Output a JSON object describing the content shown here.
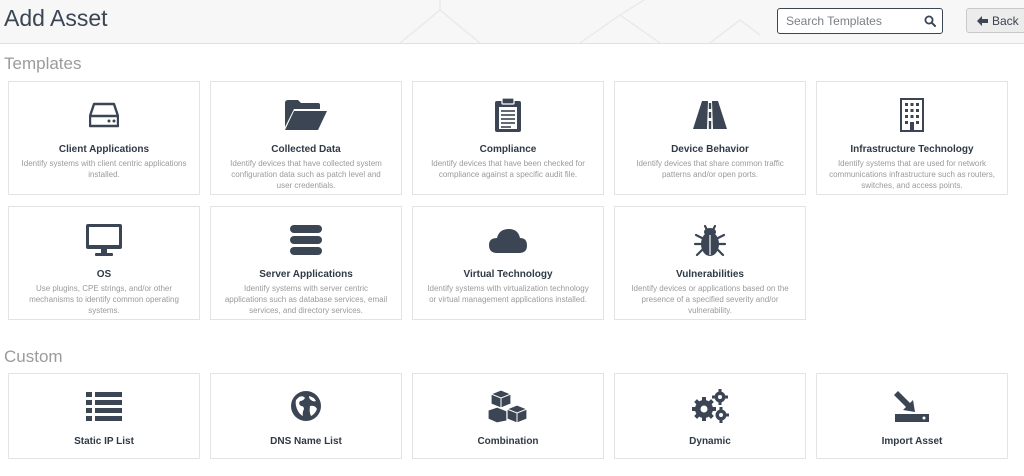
{
  "header": {
    "title": "Add Asset",
    "search_placeholder": "Search Templates",
    "back_label": "Back"
  },
  "templates_section": {
    "title": "Templates",
    "cards": [
      {
        "title": "Client Applications",
        "desc": "Identify systems with client centric applications installed.",
        "icon": "hdd-icon"
      },
      {
        "title": "Collected Data",
        "desc": "Identify devices that have collected system configuration data such as patch level and user credentials.",
        "icon": "folder-open-icon"
      },
      {
        "title": "Compliance",
        "desc": "Identify devices that have been checked for compliance against a specific audit file.",
        "icon": "clipboard-icon"
      },
      {
        "title": "Device Behavior",
        "desc": "Identify devices that share common traffic patterns and/or open ports.",
        "icon": "road-icon"
      },
      {
        "title": "Infrastructure Technology",
        "desc": "Identify systems that are used for network communications infrastructure such as routers, switches, and access points.",
        "icon": "building-icon"
      },
      {
        "title": "OS",
        "desc": "Use plugins, CPE strings, and/or other mechanisms to identify common operating systems.",
        "icon": "monitor-icon"
      },
      {
        "title": "Server Applications",
        "desc": "Identify systems with server centric applications such as database services, email services, and directory services.",
        "icon": "server-icon"
      },
      {
        "title": "Virtual Technology",
        "desc": "Identify systems with virtualization technology or virtual management applications installed.",
        "icon": "cloud-icon"
      },
      {
        "title": "Vulnerabilities",
        "desc": "Identify devices or applications based on the presence of a specified severity and/or vulnerability.",
        "icon": "bug-icon"
      }
    ]
  },
  "custom_section": {
    "title": "Custom",
    "cards": [
      {
        "title": "Static IP List",
        "icon": "list-icon"
      },
      {
        "title": "DNS Name List",
        "icon": "globe-icon"
      },
      {
        "title": "Combination",
        "icon": "cubes-icon"
      },
      {
        "title": "Dynamic",
        "icon": "gears-icon"
      },
      {
        "title": "Import Asset",
        "icon": "import-icon"
      }
    ]
  },
  "colors": {
    "icon": "#3b4554",
    "section_title": "#9b9b9b",
    "card_border": "#e3e3e3",
    "header_bg": "#f7f7f7"
  }
}
